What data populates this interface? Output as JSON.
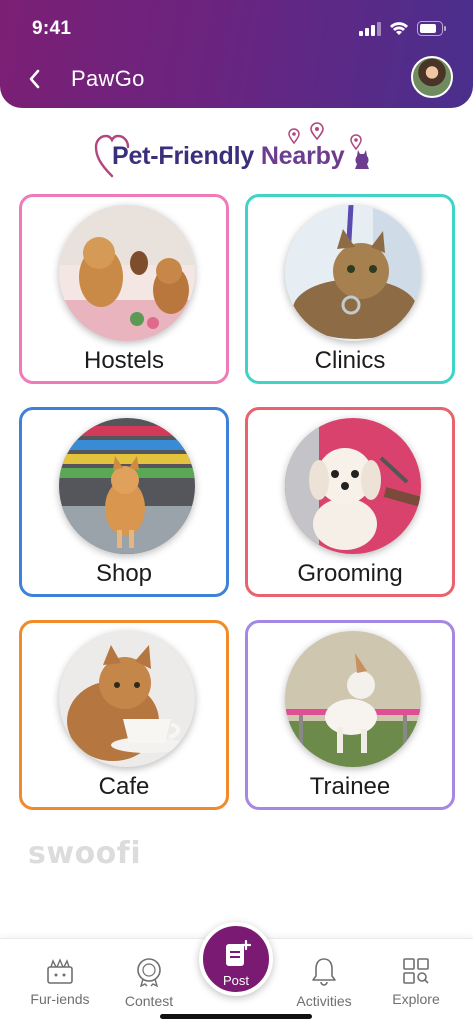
{
  "status_bar": {
    "time": "9:41"
  },
  "header": {
    "title": "PawGo"
  },
  "heading": {
    "part1": "Pet-Friendly ",
    "part2": "Nearby"
  },
  "cards": [
    {
      "label": "Hostels",
      "border_color": "#ef7ab7"
    },
    {
      "label": "Clinics",
      "border_color": "#40d4c6"
    },
    {
      "label": "Shop",
      "border_color": "#3d82d8"
    },
    {
      "label": "Grooming",
      "border_color": "#e8636e"
    },
    {
      "label": "Cafe",
      "border_color": "#f08a2a"
    },
    {
      "label": "Trainee",
      "border_color": "#a488e3"
    }
  ],
  "watermark": "swoofi",
  "bottom_nav": {
    "items": [
      {
        "label": "Fur-iends",
        "icon": "pets-icon"
      },
      {
        "label": "Contest",
        "icon": "award-icon"
      },
      {
        "label": "Post",
        "icon": "post-add-icon"
      },
      {
        "label": "Activities",
        "icon": "bell-icon"
      },
      {
        "label": "Explore",
        "icon": "grid-search-icon"
      }
    ]
  },
  "colors": {
    "header_start": "#7b1f74",
    "header_end": "#4a2f8d",
    "post_button": "#7a1a72"
  }
}
